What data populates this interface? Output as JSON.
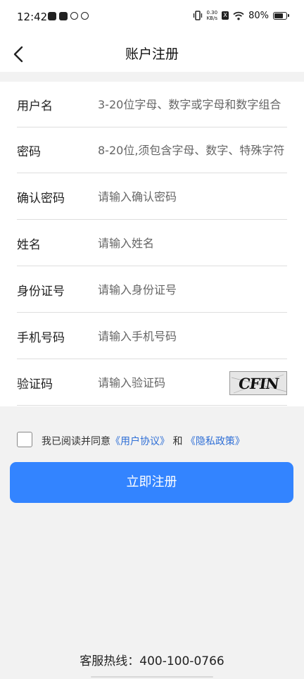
{
  "status_bar": {
    "time": "12:42",
    "net_speed_value": "0.30",
    "net_speed_unit": "KB/s",
    "sim_badge": "X",
    "battery_text": "80%",
    "battery_level": 0.8
  },
  "nav": {
    "title": "账户注册"
  },
  "form": {
    "username": {
      "label": "用户名",
      "placeholder": "3-20位字母、数字或字母和数字组合"
    },
    "password": {
      "label": "密码",
      "placeholder": "8-20位,须包含字母、数字、特殊字符"
    },
    "confirm_password": {
      "label": "确认密码",
      "placeholder": "请输入确认密码"
    },
    "name": {
      "label": "姓名",
      "placeholder": "请输入姓名"
    },
    "id_number": {
      "label": "身份证号",
      "placeholder": "请输入身份证号"
    },
    "phone": {
      "label": "手机号码",
      "placeholder": "请输入手机号码"
    },
    "captcha": {
      "label": "验证码",
      "placeholder": "请输入验证码",
      "image_text": "CFIN"
    }
  },
  "agreement": {
    "prefix": "我已阅读并同意",
    "user_agreement": "《用户协议》",
    "conjunction": "和",
    "privacy_policy": "《隐私政策》"
  },
  "register_button": "立即注册",
  "hotline": "客服热线：400-100-0766",
  "colors": {
    "primary": "#3384ff",
    "link": "#2f6fd6",
    "background": "#f2f2f2"
  }
}
